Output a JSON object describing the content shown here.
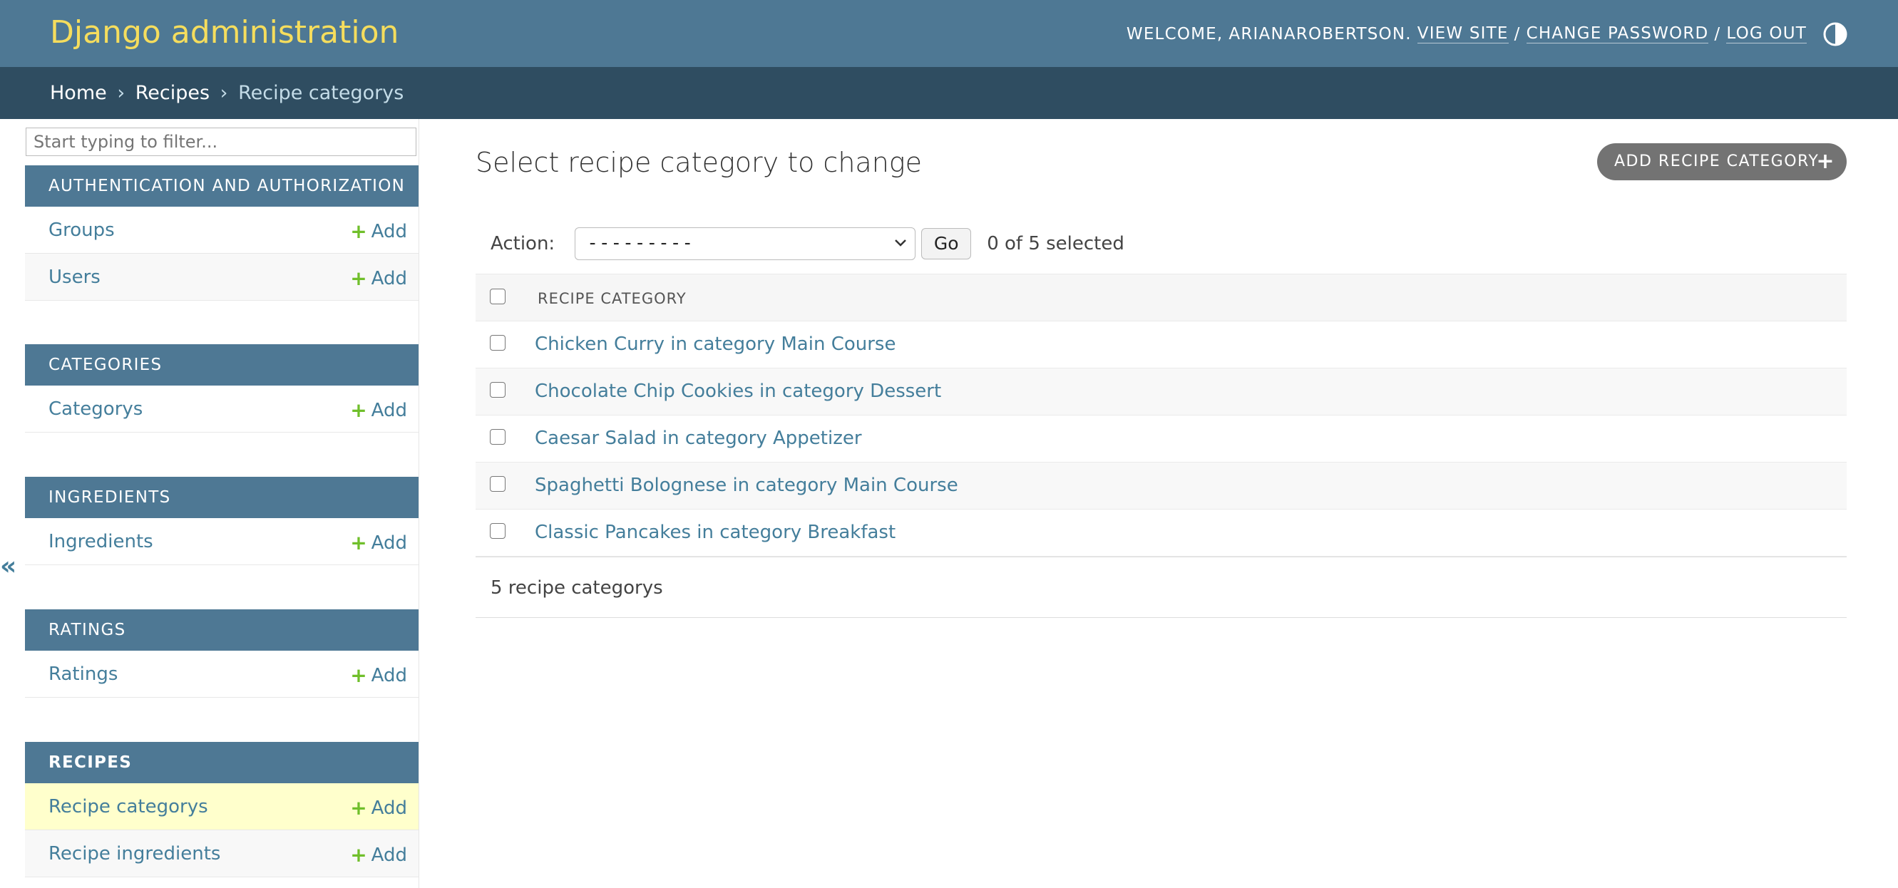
{
  "header": {
    "brand": "Django administration",
    "welcome": "WELCOME,",
    "username": "ARIANAROBERTSON.",
    "view_site": "VIEW SITE",
    "sep": "/",
    "change_password": "CHANGE PASSWORD",
    "log_out": "LOG OUT",
    "theme_icon": "half-circle-icon"
  },
  "breadcrumbs": {
    "home": "Home",
    "arrow": "›",
    "app": "Recipes",
    "current": "Recipe categorys"
  },
  "sidebar": {
    "filter_placeholder": "Start typing to filter...",
    "collapse_glyph": "«",
    "add_label": "Add",
    "modules": [
      {
        "caption": "AUTHENTICATION AND AUTHORIZATION",
        "items": [
          "Groups",
          "Users"
        ]
      },
      {
        "caption": "CATEGORIES",
        "items": [
          "Categorys"
        ]
      },
      {
        "caption": "INGREDIENTS",
        "items": [
          "Ingredients"
        ]
      },
      {
        "caption": "RATINGS",
        "items": [
          "Ratings"
        ]
      },
      {
        "caption": "RECIPES",
        "items": [
          "Recipe categorys",
          "Recipe ingredients"
        ]
      }
    ]
  },
  "main": {
    "title": "Select recipe category to change",
    "add_button": "ADD RECIPE CATEGORY",
    "action_label": "Action:",
    "action_selected": "---------",
    "go_label": "Go",
    "selected_count": "0 of 5 selected",
    "column_header": "RECIPE CATEGORY",
    "rows": [
      "Chicken Curry in category Main Course",
      "Chocolate Chip Cookies in category Dessert",
      "Caesar Salad in category Appetizer",
      "Spaghetti Bolognese in category Main Course",
      "Classic Pancakes in category Breakfast"
    ],
    "result_count": "5 recipe categorys"
  },
  "colors": {
    "header_bg": "#4e7894",
    "breadcrumb_bg": "#2f4d61",
    "brand": "#f5dd5d",
    "link": "#447e9b",
    "add_plus": "#70bf2b",
    "current_row": "#ffffcc"
  }
}
